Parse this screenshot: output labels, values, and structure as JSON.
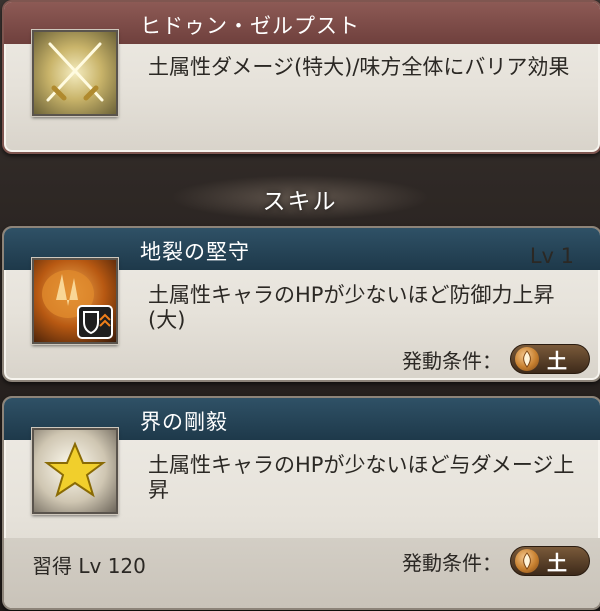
{
  "ougi": {
    "name": "ヒドゥン・ゼルプスト",
    "description": "土属性ダメージ(特大)/味方全体にバリア効果",
    "icon": "crossed-swords-icon"
  },
  "section": {
    "title": "スキル"
  },
  "skills": [
    {
      "name": "地裂の堅守",
      "level": "Lv 1",
      "description": "土属性キャラのHPが少ないほど防御力上昇(大)",
      "condition_label": "発動条件：",
      "element": "土",
      "icon": "shield-defense-up-icon"
    },
    {
      "name": "界の剛毅",
      "description": "土属性キャラのHPが少ないほど与ダメージ上昇",
      "learn_text": "習得 Lv 120",
      "condition_label": "発動条件：",
      "element": "土",
      "icon": "star-icon"
    }
  ],
  "colors": {
    "ougi_header": "#7a4a46",
    "skill_header": "#27475a",
    "earth": "#c7802f"
  }
}
